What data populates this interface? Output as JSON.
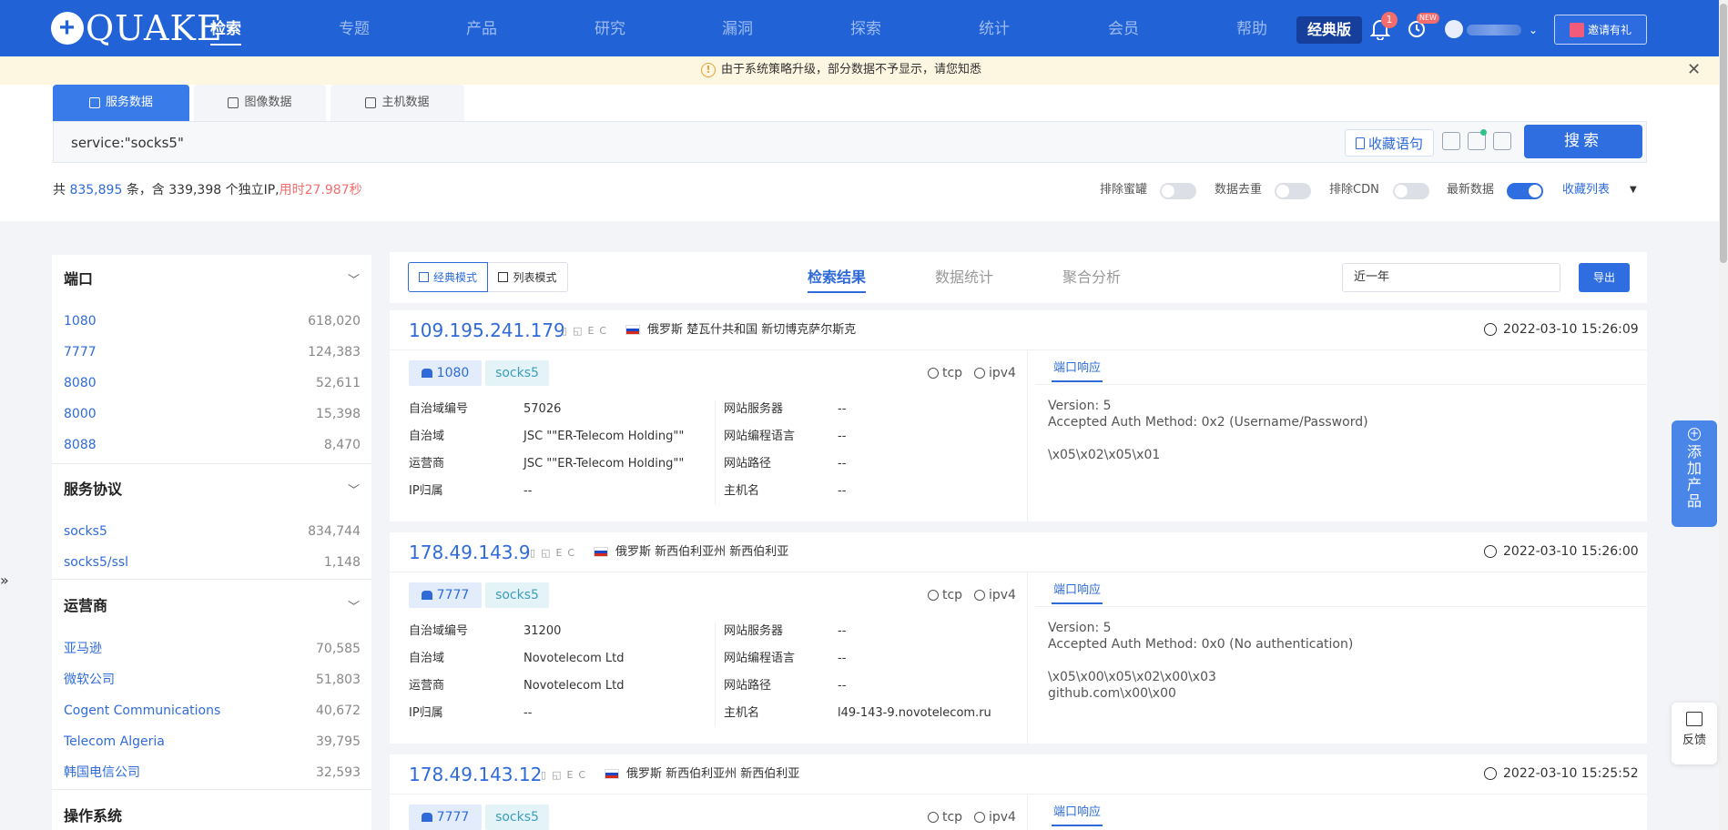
{
  "header": {
    "logo": "QUAKE",
    "nav": [
      "检索",
      "专题",
      "产品",
      "研究",
      "漏洞",
      "探索",
      "统计",
      "会员",
      "帮助"
    ],
    "classic_label": "经典版",
    "notification_count": "1",
    "new_badge": "NEW",
    "invite_label": "邀请有礼"
  },
  "notice": {
    "text": "由于系统策略升级，部分数据不予显示，请您知悉"
  },
  "tabs": [
    "服务数据",
    "图像数据",
    "主机数据"
  ],
  "search": {
    "query": "service:\"socks5\"",
    "fav_label": "收藏语句",
    "button_label": "搜索"
  },
  "stats": {
    "prefix": "共",
    "total": "835,895",
    "mid": "条，含 339,398 个独立IP,",
    "time": "用时27.987秒"
  },
  "toggles": [
    {
      "label": "排除蜜罐",
      "on": false
    },
    {
      "label": "数据去重",
      "on": false
    },
    {
      "label": "排除CDN",
      "on": false
    },
    {
      "label": "最新数据",
      "on": true
    }
  ],
  "fav_list_label": "收藏列表",
  "sidebar": {
    "sections": [
      {
        "title": "端口",
        "items": [
          {
            "label": "1080",
            "count": "618,020"
          },
          {
            "label": "7777",
            "count": "124,383"
          },
          {
            "label": "8080",
            "count": "52,611"
          },
          {
            "label": "8000",
            "count": "15,398"
          },
          {
            "label": "8088",
            "count": "8,470"
          }
        ]
      },
      {
        "title": "服务协议",
        "items": [
          {
            "label": "socks5",
            "count": "834,744"
          },
          {
            "label": "socks5/ssl",
            "count": "1,148"
          }
        ]
      },
      {
        "title": "运营商",
        "items": [
          {
            "label": "亚马逊",
            "count": "70,585"
          },
          {
            "label": "微软公司",
            "count": "51,803"
          },
          {
            "label": "Cogent Communications",
            "count": "40,672"
          },
          {
            "label": "Telecom Algeria",
            "count": "39,795"
          },
          {
            "label": "韩国电信公司",
            "count": "32,593"
          }
        ]
      },
      {
        "title": "操作系统",
        "items": []
      }
    ]
  },
  "main": {
    "modes": [
      "经典模式",
      "列表模式"
    ],
    "tabs": [
      "检索结果",
      "数据统计",
      "聚合分析"
    ],
    "period": "近一年",
    "export_label": "导出",
    "field_labels": {
      "asn": "自治域编号",
      "as": "自治域",
      "isp": "运营商",
      "ip_loc": "IP归属",
      "server": "网站服务器",
      "lang": "网站编程语言",
      "path": "网站路径",
      "host": "主机名"
    },
    "resp_tab": "端口响应",
    "icons_text": "EC",
    "results": [
      {
        "ip": "109.195.241.179",
        "location": "俄罗斯 楚瓦什共和国 新切博克萨尔斯克",
        "timestamp": "2022-03-10 15:26:09",
        "port": "1080",
        "service": "socks5",
        "transport": "tcp",
        "ipver": "ipv4",
        "asn": "57026",
        "as": "JSC \"\"ER-Telecom Holding\"\"",
        "isp": "JSC \"\"ER-Telecom Holding\"\"",
        "ip_loc": "--",
        "server": "--",
        "lang": "--",
        "path": "--",
        "host": "--",
        "response": "Version: 5\nAccepted Auth Method: 0x2 (Username/Password)\n\n\\x05\\x02\\x05\\x01"
      },
      {
        "ip": "178.49.143.9",
        "location": "俄罗斯 新西伯利亚州 新西伯利亚",
        "timestamp": "2022-03-10 15:26:00",
        "port": "7777",
        "service": "socks5",
        "transport": "tcp",
        "ipver": "ipv4",
        "asn": "31200",
        "as": "Novotelecom Ltd",
        "isp": "Novotelecom Ltd",
        "ip_loc": "--",
        "server": "--",
        "lang": "--",
        "path": "--",
        "host": "l49-143-9.novotelecom.ru",
        "response": "Version: 5\nAccepted Auth Method: 0x0 (No authentication)\n\n\\x05\\x00\\x05\\x02\\x00\\x03\ngithub.com\\x00\\x00"
      },
      {
        "ip": "178.49.143.12",
        "location": "俄罗斯 新西伯利亚州 新西伯利亚",
        "timestamp": "2022-03-10 15:25:52",
        "port": "7777",
        "service": "socks5",
        "transport": "tcp",
        "ipver": "ipv4"
      }
    ]
  },
  "floating": {
    "add_product": "添加产品",
    "feedback": "反馈"
  }
}
